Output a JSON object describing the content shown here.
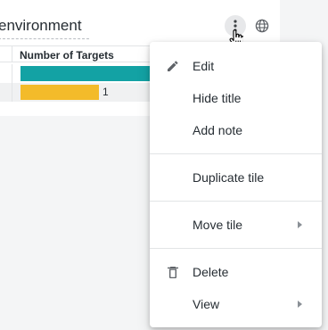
{
  "tile": {
    "title": "environment",
    "column_header": "Number of Targets",
    "rows": [
      {
        "value_label": "",
        "bar_fraction": 1.0,
        "color": "#13a2a4"
      },
      {
        "value_label": "1",
        "bar_fraction": 0.5,
        "color": "#f3bb2a"
      }
    ]
  },
  "menu": {
    "items": [
      {
        "label": "Edit",
        "icon": "pencil-icon",
        "submenu": false
      },
      {
        "label": "Hide title",
        "icon": "",
        "submenu": false
      },
      {
        "label": "Add note",
        "icon": "",
        "submenu": false
      },
      {
        "label": "Duplicate tile",
        "icon": "",
        "submenu": false
      },
      {
        "label": "Move tile",
        "icon": "",
        "submenu": true
      },
      {
        "label": "Delete",
        "icon": "trash-icon",
        "submenu": false
      },
      {
        "label": "View",
        "icon": "",
        "submenu": true
      }
    ]
  },
  "colors": {
    "teal": "#13a2a4",
    "yellow": "#f3bb2a",
    "text": "#262d33",
    "icon": "#5f6368"
  }
}
